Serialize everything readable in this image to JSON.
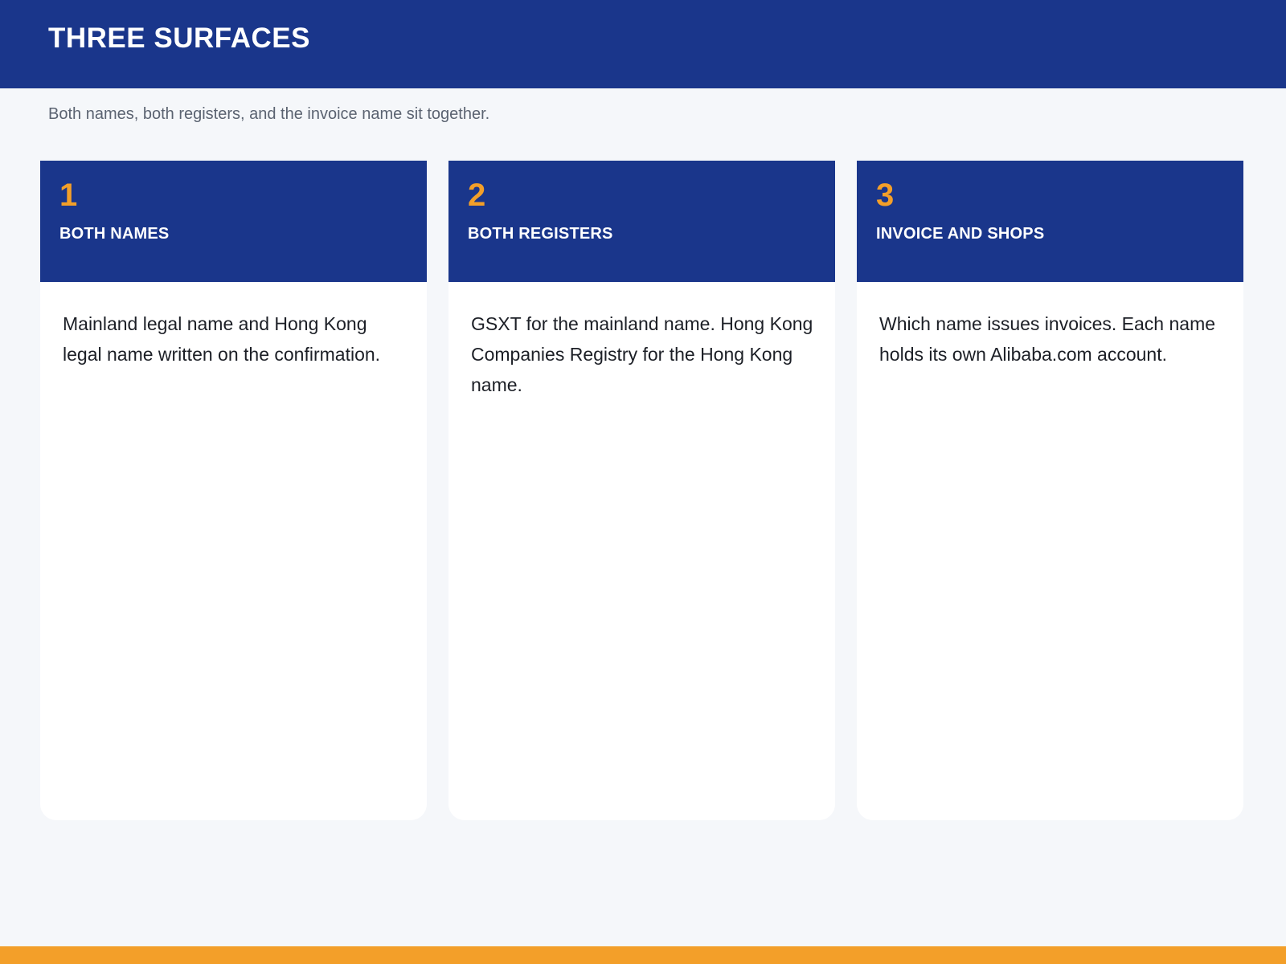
{
  "header": {
    "title": "THREE SURFACES"
  },
  "subtitle": "Both names, both registers, and the invoice name sit together.",
  "cards": [
    {
      "number": "1",
      "title": "BOTH NAMES",
      "body": "Mainland legal name and Hong Kong legal name written on the confirmation."
    },
    {
      "number": "2",
      "title": "BOTH REGISTERS",
      "body": "GSXT for the mainland name. Hong Kong Companies Registry for the Hong Kong name."
    },
    {
      "number": "3",
      "title": "INVOICE AND SHOPS",
      "body": "Which name issues invoices. Each name holds its own Alibaba.com account."
    }
  ],
  "colors": {
    "primary": "#1a368b",
    "accent": "#f39f29",
    "background": "#f5f7fa"
  }
}
